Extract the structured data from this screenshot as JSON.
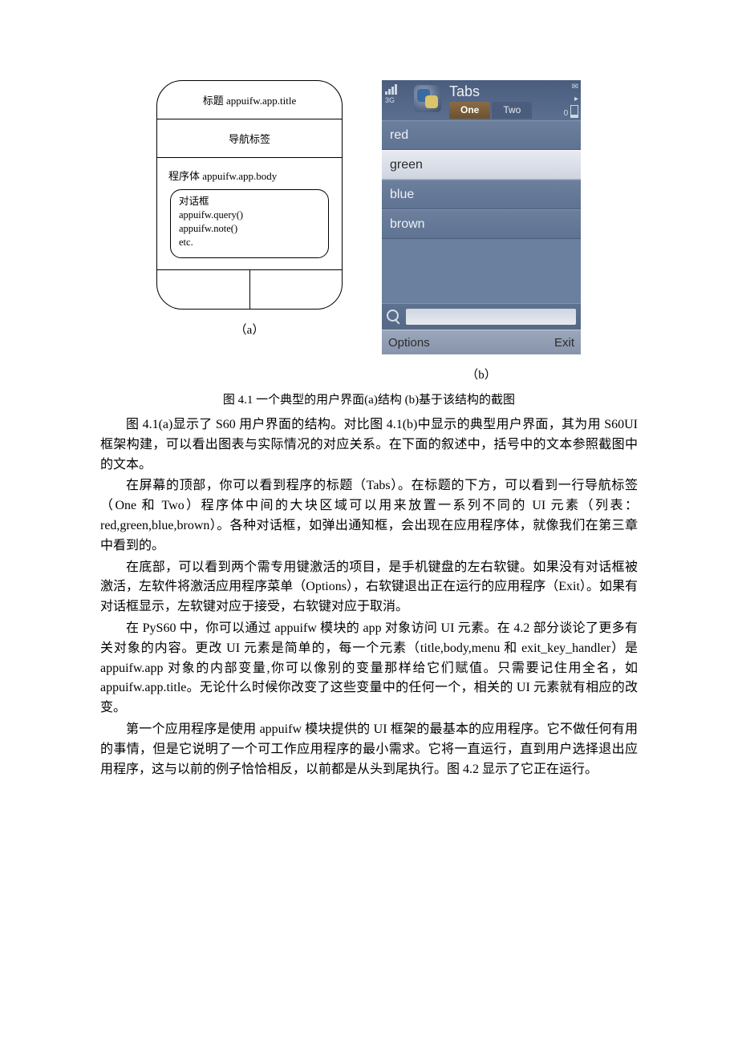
{
  "diagram": {
    "title_row": "标题  appuifw.app.title",
    "nav_row": "导航标签",
    "body_label": "程序体  appuifw.app.body",
    "dialog": {
      "l1": "对话框",
      "l2": "appuifw.query()",
      "l3": "appuifw.note()",
      "l4": "etc."
    },
    "sub_label": "（a）"
  },
  "screenshot": {
    "signal_label": "3G",
    "app_title": "Tabs",
    "tabs": [
      "One",
      "Two"
    ],
    "active_tab_index": 0,
    "battery_label": "0",
    "list": [
      "red",
      "green",
      "blue",
      "brown"
    ],
    "selected_index": 1,
    "left_softkey": "Options",
    "right_softkey": "Exit",
    "sub_label": "（b）"
  },
  "caption": "图 4.1 一个典型的用户界面(a)结构  (b)基于该结构的截图",
  "paragraphs": {
    "p1": "图 4.1(a)显示了 S60 用户界面的结构。对比图 4.1(b)中显示的典型用户界面，其为用 S60UI 框架构建，可以看出图表与实际情况的对应关系。在下面的叙述中，括号中的文本参照截图中的文本。",
    "p2": "在屏幕的顶部，你可以看到程序的标题（Tabs）。在标题的下方，可以看到一行导航标签（One 和 Two）程序体中间的大块区域可以用来放置一系列不同的 UI 元素（列表：red,green,blue,brown）。各种对话框，如弹出通知框，会出现在应用程序体，就像我们在第三章中看到的。",
    "p3": "在底部，可以看到两个需专用键激活的项目，是手机键盘的左右软键。如果没有对话框被激活，左软件将激活应用程序菜单（Options），右软键退出正在运行的应用程序（Exit）。如果有对话框显示，左软键对应于接受，右软键对应于取消。",
    "p4": "在 PyS60 中，你可以通过 appuifw 模块的 app 对象访问 UI 元素。在 4.2 部分谈论了更多有关对象的内容。更改 UI 元素是简单的，每一个元素（title,body,menu 和 exit_key_handler）是 appuifw.app 对象的内部变量,你可以像别的变量那样给它们赋值。只需要记住用全名，如 appuifw.app.title。无论什么时候你改变了这些变量中的任何一个，相关的 UI 元素就有相应的改变。",
    "p5": "第一个应用程序是使用 appuifw 模块提供的 UI 框架的最基本的应用程序。它不做任何有用的事情，但是它说明了一个可工作应用程序的最小需求。它将一直运行，直到用户选择退出应用程序，这与以前的例子恰恰相反，以前都是从头到尾执行。图 4.2 显示了它正在运行。"
  }
}
